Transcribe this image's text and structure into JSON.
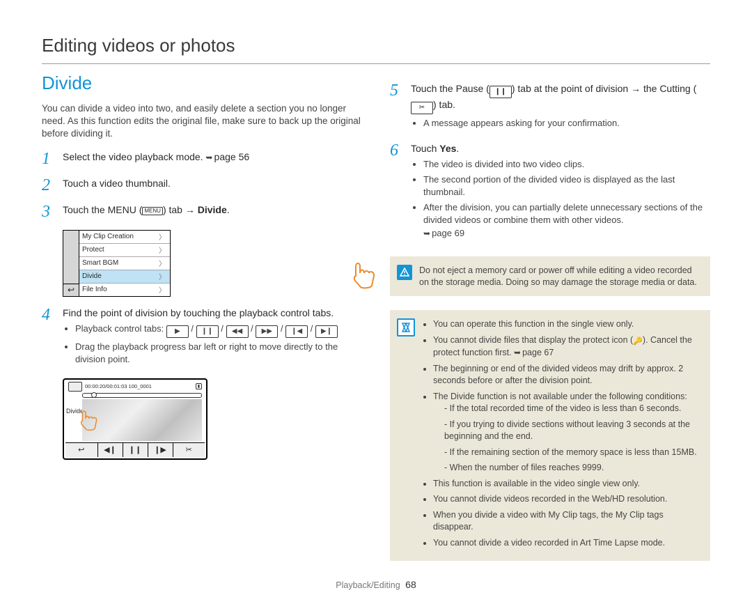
{
  "header": {
    "title": "Editing videos or photos"
  },
  "section": {
    "title": "Divide",
    "intro": "You can divide a video into two, and easily delete a section you no longer need. As this function edits the original file, make sure to back up the original before dividing it."
  },
  "steps": {
    "s1": {
      "num": "1",
      "text": "Select the video playback mode.",
      "ref": "page 56"
    },
    "s2": {
      "num": "2",
      "text": "Touch a video thumbnail."
    },
    "s3": {
      "num": "3",
      "prefix": "Touch the MENU (",
      "menu": "MENU",
      "mid": ") tab",
      "arrow": " → ",
      "target": "Divide",
      "suffix": "."
    },
    "s4": {
      "num": "4",
      "text": "Find the point of division by touching the playback control tabs.",
      "b1_label": "Playback control tabs:",
      "b2": "Drag the playback progress bar left or right to move directly to the division point."
    },
    "s5": {
      "num": "5",
      "prefix": "Touch the Pause (",
      "mid1": ") tab at the point of division",
      "arrow": " → ",
      "mid2": "the Cutting (",
      "mid3": ") tab.",
      "b1": "A message appears asking for your confirmation."
    },
    "s6": {
      "num": "6",
      "prefix": "Touch ",
      "yes": "Yes",
      "suffix": ".",
      "b1": "The video is divided into two video clips.",
      "b2": "The second portion of the divided video is displayed as the last thumbnail.",
      "b3": "After the division, you can partially delete unnecessary sections of the divided videos or combine them with other videos.",
      "ref": "page 69"
    }
  },
  "menu_screen": {
    "items": [
      "My Clip Creation",
      "Protect",
      "Smart BGM",
      "Divide",
      "File Info"
    ],
    "back": "↩"
  },
  "playback_screen": {
    "timestamp": "00:00:20/00:01:03  100_0001",
    "side_label": "Divide",
    "controls": {
      "back": "↩",
      "prev": "◀❙",
      "pause": "❙❙",
      "next": "❙▶",
      "cut": "✂"
    }
  },
  "warning_box": {
    "text": "Do not eject a memory card or power off while editing a video recorded on the storage media. Doing so may damage the storage media or data."
  },
  "info_box": {
    "l1": "You can operate this function in the single view only.",
    "l2a": "You cannot divide files that display the protect icon (",
    "l2b": "). Cancel the protect function first.",
    "l2ref": "page 67",
    "l3": "The beginning or end of the divided videos may drift by approx. 2 seconds before or after the division point.",
    "l4": "The Divide function is not available under the following conditions:",
    "l4a": "If the total recorded time of the video is less than 6 seconds.",
    "l4b": "If you trying to divide sections without leaving 3 seconds at the beginning and the end.",
    "l4c": "If the remaining section of the memory space is less than 15MB.",
    "l4d": "When the number of files reaches 9999.",
    "l5": "This function is available in the video single view only.",
    "l6": "You cannot divide videos recorded in the Web/HD resolution.",
    "l7": "When you divide a video with My Clip tags, the My Clip tags disappear.",
    "l8": "You cannot divide a video recorded in Art Time Lapse mode."
  },
  "icons": {
    "play": "▶",
    "pause": "❙❙",
    "rew": "◀◀",
    "ff": "▶▶",
    "prev": "❙◀",
    "next": "▶❙",
    "cut": "✂",
    "protect": "🔑"
  },
  "footer": {
    "section": "Playback/Editing",
    "page": "68"
  }
}
